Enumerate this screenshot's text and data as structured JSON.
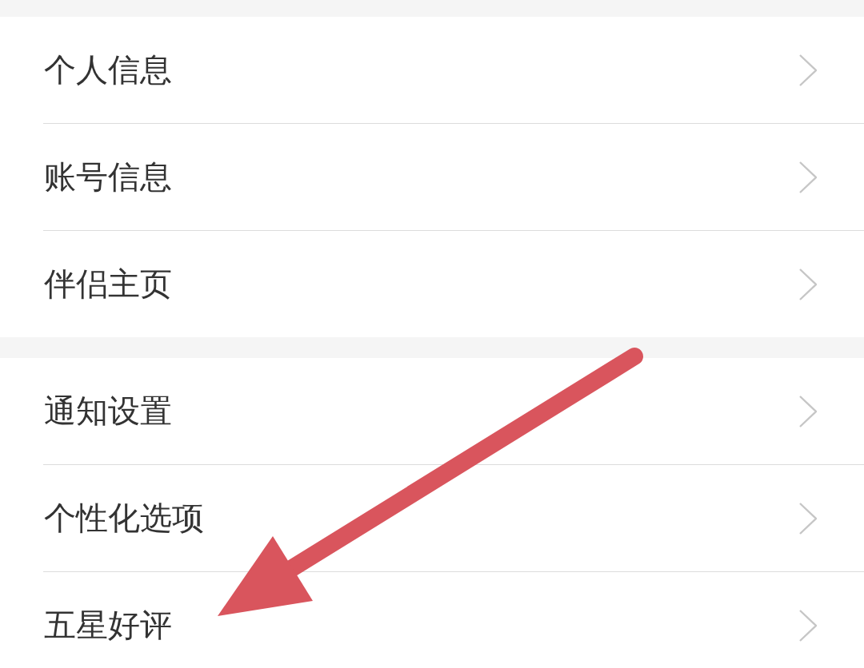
{
  "sections": [
    {
      "items": [
        {
          "label": "个人信息"
        },
        {
          "label": "账号信息"
        },
        {
          "label": "伴侣主页"
        }
      ]
    },
    {
      "items": [
        {
          "label": "通知设置"
        },
        {
          "label": "个性化选项"
        },
        {
          "label": "五星好评"
        }
      ]
    }
  ]
}
